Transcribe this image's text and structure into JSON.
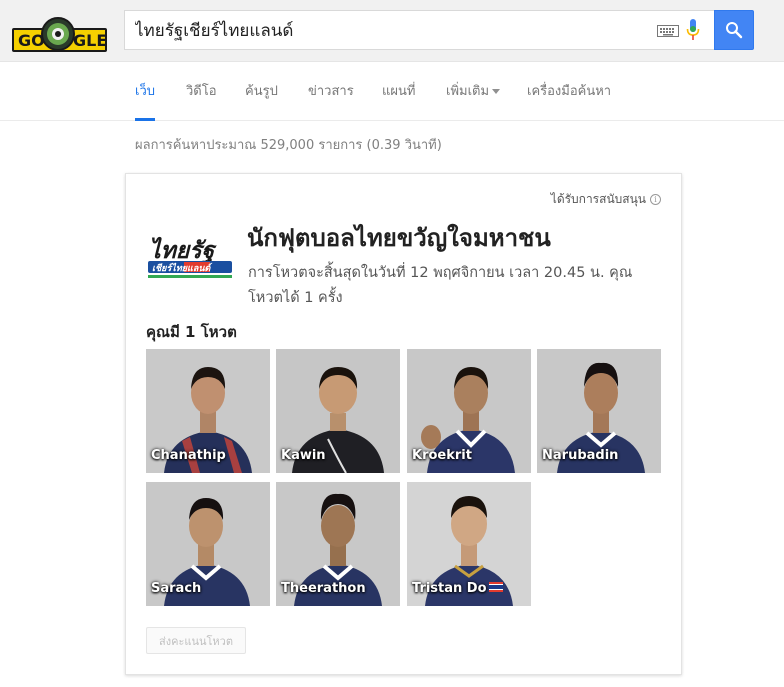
{
  "logo": {
    "text": "GO   GLE",
    "colors": {
      "bg": "#1a1a1a",
      "text": "#f5d000"
    }
  },
  "search": {
    "query": "ไทยรัฐเชียร์ไทยแลนด์",
    "keyboard_icon": "keyboard-icon",
    "mic_icon": "mic-icon",
    "search_icon": "search-icon"
  },
  "nav": {
    "tabs": [
      {
        "label": "เว็บ",
        "active": true
      },
      {
        "label": "วิดีโอ"
      },
      {
        "label": "ค้นรูป"
      },
      {
        "label": "ข่าวสาร"
      },
      {
        "label": "แผนที่"
      },
      {
        "label": "เพิ่มเติม"
      },
      {
        "label": "เครื่องมือค้นหา"
      }
    ]
  },
  "result_stats": "ผลการค้นหาประมาณ 529,000 รายการ (0.39 วินาที)",
  "card": {
    "sponsored": "ได้รับการสนับสนุน",
    "brand_logo": {
      "line1": "ไทยรัฐ",
      "line2": "เชียร์ไทยแลนด์"
    },
    "title": "นักฟุตบอลไทยขวัญใจมหาชน",
    "subtitle": "การโหวตจะสิ้นสุดในวันที่ 12 พฤศจิกายน เวลา 20.45 น. คุณโหวตได้ 1 ครั้ง",
    "vote_count": "คุณมี 1 โหวต",
    "players": [
      {
        "name": "Chanathip"
      },
      {
        "name": "Kawin"
      },
      {
        "name": "Kroekrit"
      },
      {
        "name": "Narubadin"
      },
      {
        "name": "Sarach"
      },
      {
        "name": "Theerathon"
      },
      {
        "name": "Tristan Do"
      }
    ],
    "submit_label": "ส่งคะแนนโหวต"
  },
  "accent": "#1a73e8",
  "search_button_color": "#4285f4"
}
